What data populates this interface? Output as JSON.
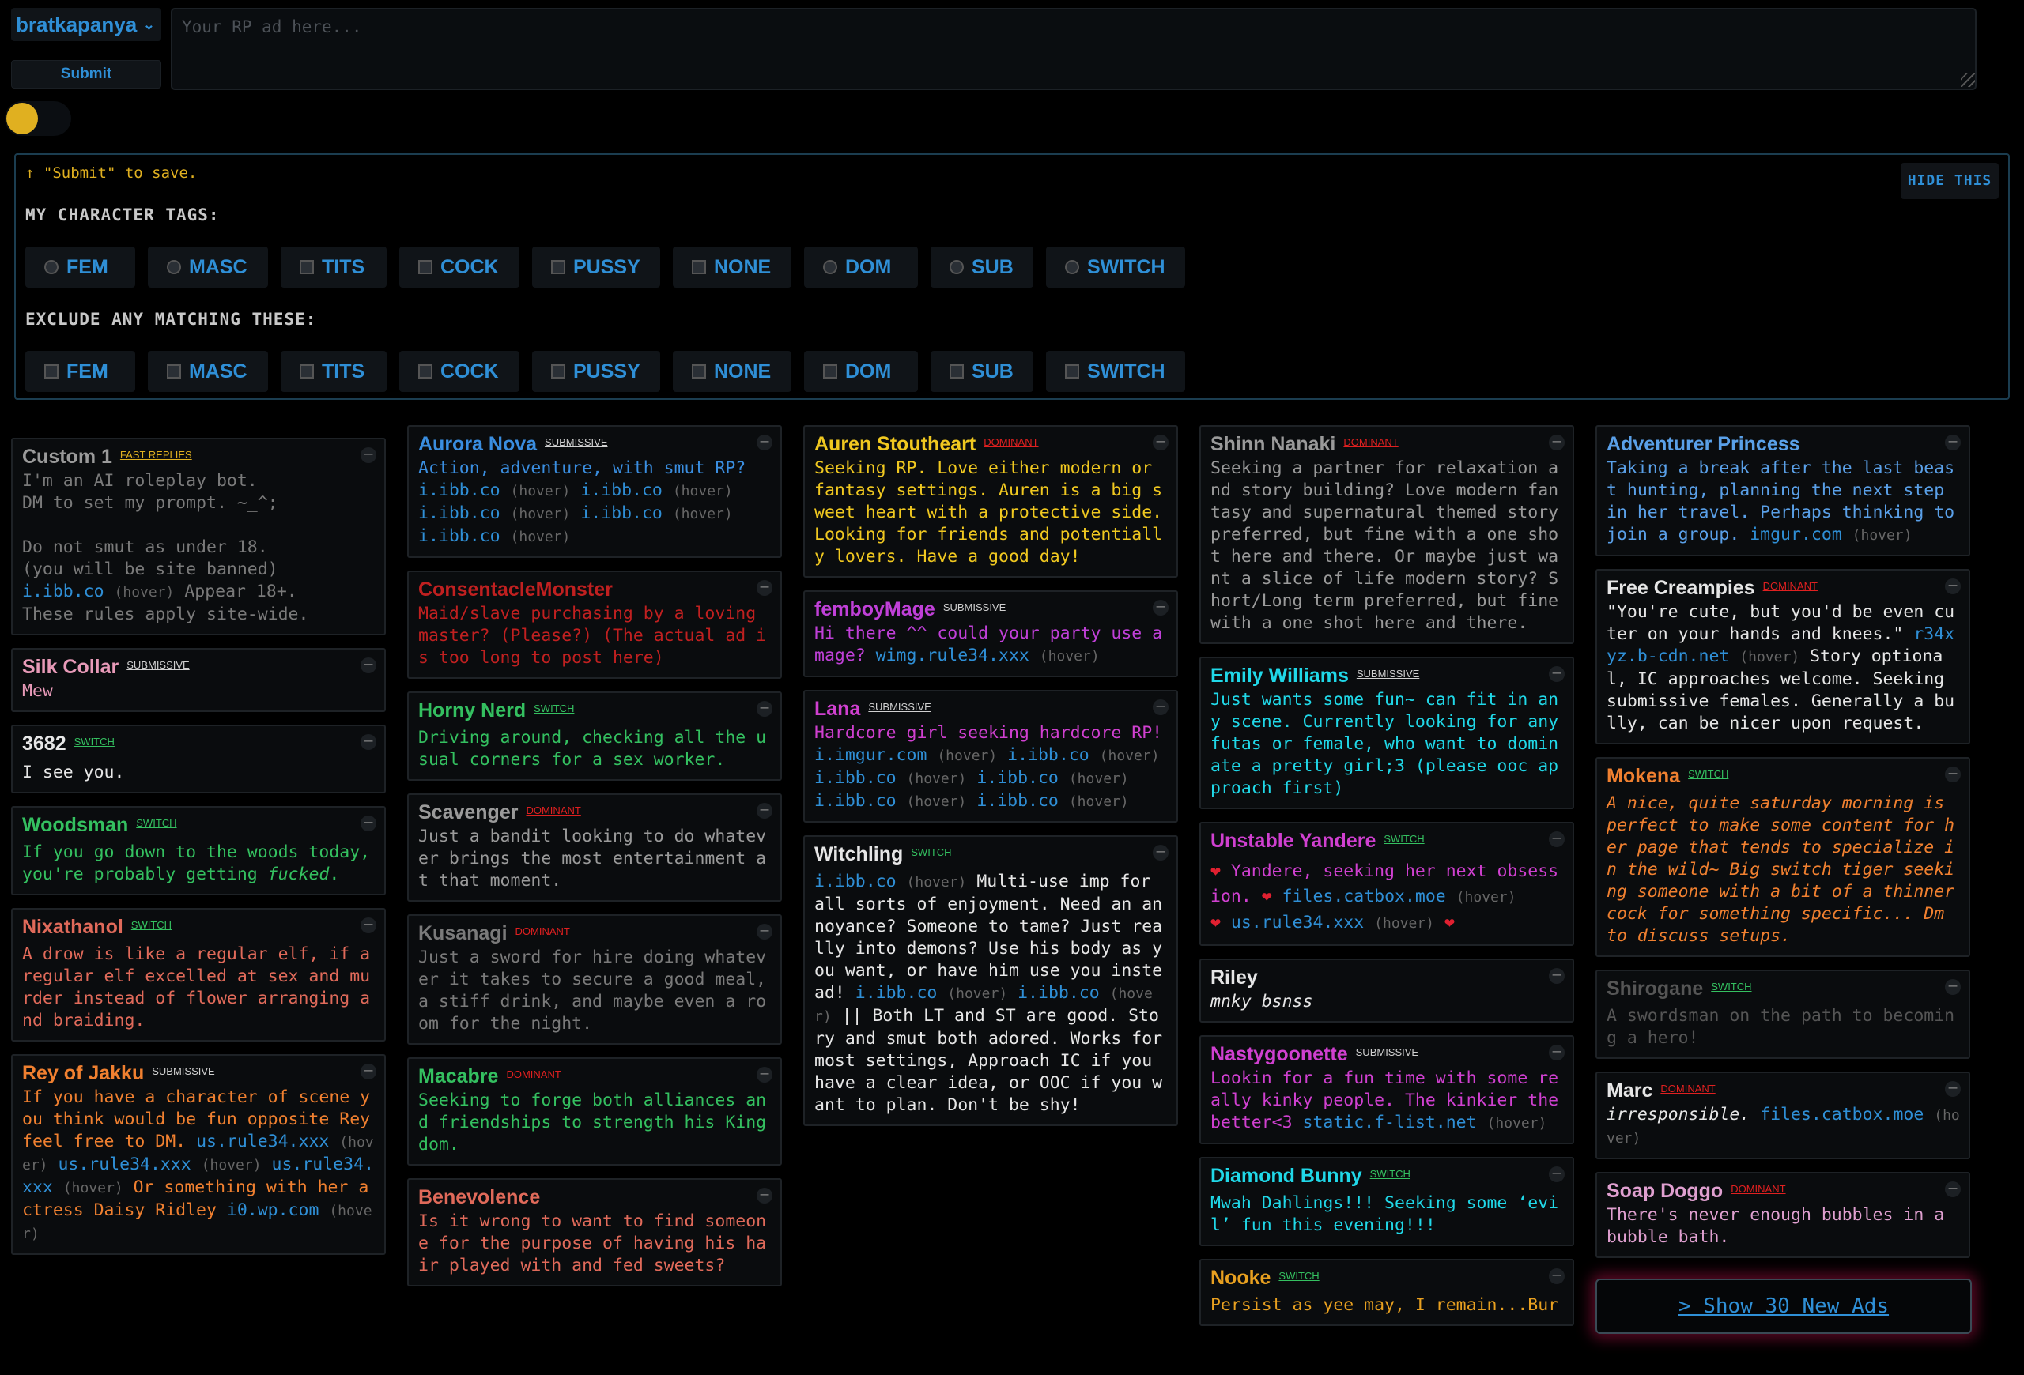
{
  "top": {
    "username": "bratkapanya",
    "submit_label": "Submit",
    "ad_placeholder": "Your RP ad here..."
  },
  "tags": {
    "hint": "↑ \"Submit\" to save.",
    "hide_label": "HIDE THIS",
    "my_title": "MY CHARACTER TAGS:",
    "exclude_title": "EXCLUDE ANY MATCHING THESE:",
    "labels": [
      "FEM",
      "MASC",
      "TITS",
      "COCK",
      "PUSSY",
      "NONE",
      "DOM",
      "SUB",
      "SWITCH"
    ]
  },
  "cards": {
    "custom1": {
      "name": "Custom 1",
      "badge": "FAST REPLIES",
      "l1": "I'm an AI roleplay bot.",
      "l2": "DM to set my prompt. ~_^;",
      "l3": "Do not smut as under 18.",
      "l4": "(you will be site banned)",
      "link": "i.ibb.co",
      "hover": "(hover)",
      "l5": "Appear 18+.",
      "l6": "These rules apply site-wide."
    },
    "silk": {
      "name": "Silk Collar",
      "badge": "SUBMISSIVE",
      "text": "Mew"
    },
    "n3682": {
      "name": "3682",
      "badge": "SWITCH",
      "text": "I see you."
    },
    "woodsman": {
      "name": "Woodsman",
      "badge": "SWITCH",
      "text": "If you go down to the woods today, you're probably getting ",
      "em": "fucked",
      "end": "."
    },
    "nixathanol": {
      "name": "Nixathanol",
      "badge": "SWITCH",
      "text": "A drow is like a regular elf, if a regular elf excelled at sex and murder instead of flower arranging and braiding."
    },
    "rey": {
      "name": "Rey of Jakku",
      "badge": "SUBMISSIVE",
      "t1": "If you have a character of scene you think would be fun opposite Rey feel free to DM. ",
      "link1": "us.rule34.xxx",
      "h1": "(hover)",
      "link2": "us.rule34.xxx",
      "h2": "(hover)",
      "link3": "us.rule34.xxx",
      "h3": "(hover)",
      "t2": " Or something with her actress Daisy Ridley ",
      "link4": "i0.wp.com",
      "h4": "(hover)"
    },
    "aurora": {
      "name": "Aurora Nova",
      "badge": "SUBMISSIVE",
      "text": "Action, adventure, with smut RP?",
      "link": "i.ibb.co",
      "hover": "(hover)"
    },
    "consentacle": {
      "name": "ConsentacleMonster",
      "text": "Maid/slave purchasing by a loving master? (Please?) (The actual ad is too long to post here)"
    },
    "hornynerd": {
      "name": "Horny Nerd",
      "badge": "SWITCH",
      "text": "Driving around, checking all the usual corners for a sex worker."
    },
    "scavenger": {
      "name": "Scavenger",
      "badge": "DOMINANT",
      "text": "Just a bandit looking to do whatever brings the most entertainment at that moment."
    },
    "kusanagi": {
      "name": "Kusanagi",
      "badge": "DOMINANT",
      "text": "Just a sword for hire doing whatever it takes to secure a good meal, a stiff drink, and maybe even a room for the night."
    },
    "macabre": {
      "name": "Macabre",
      "badge": "DOMINANT",
      "text": "Seeking to forge both alliances and friendships to strength his Kingdom."
    },
    "benevolence": {
      "name": "Benevolence",
      "text": "Is it wrong to want to find someone for the purpose of having his hair played with and fed sweets?"
    },
    "auren": {
      "name": "Auren Stoutheart",
      "badge": "DOMINANT",
      "text": "Seeking RP. Love either modern or fantasy settings. Auren is a big sweet heart with a protective side. Looking for friends and potentially lovers. Have a good day!"
    },
    "femboy": {
      "name": "femboyMage",
      "badge": "SUBMISSIVE",
      "text": "Hi there ^^ could your party use a mage? ",
      "link": "wimg.rule34.xxx",
      "hover": "(hover)"
    },
    "lana": {
      "name": "Lana",
      "badge": "SUBMISSIVE",
      "text": "Hardcore girl seeking hardcore RP!",
      "link1": "i.imgur.com",
      "link2": "i.ibb.co",
      "hover": "(hover)"
    },
    "witchling": {
      "name": "Witchling",
      "badge": "SWITCH",
      "link": "i.ibb.co",
      "hover": "(hover)",
      "t1": " Multi-use imp for all sorts of enjoyment. Need an annoyance? Someone to tame? Just really into demons? Use his body as you want, or have him use you instead! ",
      "t2": " || Both LT and ST are good. Story and smut both adored. Works for most settings, Approach IC if you have a clear idea, or OOC if you want to plan. Don't be shy!"
    },
    "shinn": {
      "name": "Shinn Nanaki",
      "badge": "DOMINANT",
      "text": "Seeking a partner for relaxation and story building? Love modern fantasy and supernatural themed story preferred, but fine with a one shot here and there. Or maybe just want a slice of life modern story? Short/Long term preferred, but fine with a one shot here and there."
    },
    "emily": {
      "name": "Emily Williams",
      "badge": "SUBMISSIVE",
      "text": "Just wants some fun~ can fit in any scene. Currently looking for any futas or female, who want to dominate a pretty girl;3 (please ooc approach first)"
    },
    "yandere": {
      "name": "Unstable Yandere",
      "badge": "SWITCH",
      "text": " Yandere, seeking her next obsession. ",
      "link1": "files.catbox.moe",
      "link2": "us.rule34.xxx",
      "hover": "(hover)"
    },
    "riley": {
      "name": "Riley",
      "text": "mnky bsnss"
    },
    "nasty": {
      "name": "Nastygoonette",
      "badge": "SUBMISSIVE",
      "text": "Lookin for a fun time with some really kinky people. The kinkier the better<3 ",
      "link": "static.f-list.net",
      "hover": "(hover)"
    },
    "diamond": {
      "name": "Diamond Bunny",
      "badge": "SWITCH",
      "text": "Mwah Dahlings!!! Seeking some ‘evil’ fun this evening!!!"
    },
    "nooke": {
      "name": "Nooke",
      "badge": "SWITCH",
      "text": "Persist as yee may, I remain...Bur"
    },
    "adventurer": {
      "name": "Adventurer Princess",
      "text": "Taking a break after the last beast hunting, planning the next step in her travel. Perhaps thinking to join a group. ",
      "link": "imgur.com",
      "hover": "(hover)"
    },
    "creampies": {
      "name": "Free Creampies",
      "badge": "DOMINANT",
      "t1": "\"You're cute, but you'd be even cuter on your hands and knees.\" ",
      "link": "r34xyz.b-cdn.net",
      "hover": "(hover)",
      "t2": " Story optional, IC approaches welcome. Seeking submissive females. Generally a bully, can be nicer upon request."
    },
    "mokena": {
      "name": "Mokena",
      "badge": "SWITCH",
      "text": "A nice, quite saturday morning is perfect to make some content for her page that tends to specialize in the wild~ Big switch tiger seeking someone with a bit of a thinner cock for something specific... Dm to discuss setups."
    },
    "shirogane": {
      "name": "Shirogane",
      "badge": "SWITCH",
      "text": "A swordsman on the path to becoming a hero!"
    },
    "marc": {
      "name": "Marc",
      "badge": "DOMINANT",
      "text": "irresponsible. ",
      "link": "files.catbox.moe",
      "hover": "(hover)"
    },
    "soap": {
      "name": "Soap Doggo",
      "badge": "DOMINANT",
      "text": "There's never enough bubbles in a bubble bath."
    }
  },
  "show_more": "> Show 30 New Ads",
  "colors": {
    "accent_blue": "#2f8fd6",
    "toggle_knob": "#e0b020",
    "panel_border": "#1b3d50",
    "glow": "#c81450"
  }
}
